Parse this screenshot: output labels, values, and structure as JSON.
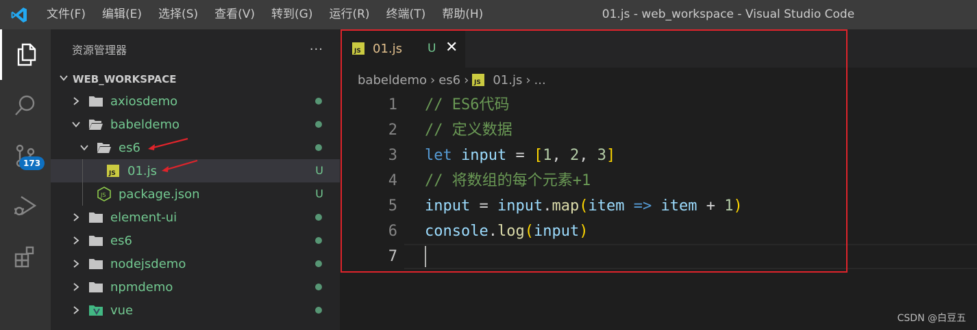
{
  "titlebar": {
    "menu": [
      "文件(F)",
      "编辑(E)",
      "选择(S)",
      "查看(V)",
      "转到(G)",
      "运行(R)",
      "终端(T)",
      "帮助(H)"
    ],
    "window_title": "01.js - web_workspace - Visual Studio Code"
  },
  "activity": {
    "scm_badge": "173",
    "icons": [
      "explorer-icon",
      "search-icon",
      "source-control-icon",
      "run-debug-icon",
      "extensions-icon"
    ]
  },
  "explorer": {
    "title": "资源管理器",
    "more": "···",
    "workspace": "WEB_WORKSPACE",
    "rows": [
      {
        "label": "axiosdemo",
        "type": "folder",
        "expanded": false,
        "status": ""
      },
      {
        "label": "babeldemo",
        "type": "folder",
        "expanded": true,
        "status": ""
      },
      {
        "label": "es6",
        "type": "folder",
        "expanded": true,
        "status": ""
      },
      {
        "label": "01.js",
        "type": "js",
        "status": "U"
      },
      {
        "label": "package.json",
        "type": "json",
        "status": "U"
      },
      {
        "label": "element-ui",
        "type": "folder",
        "expanded": false,
        "status": ""
      },
      {
        "label": "es6",
        "type": "folder",
        "expanded": false,
        "status": ""
      },
      {
        "label": "nodejsdemo",
        "type": "folder",
        "expanded": false,
        "status": ""
      },
      {
        "label": "npmdemo",
        "type": "folder",
        "expanded": false,
        "status": ""
      },
      {
        "label": "vue",
        "type": "vue-folder",
        "expanded": false,
        "status": ""
      }
    ]
  },
  "editor": {
    "tab": {
      "icon": "JS",
      "label": "01.js",
      "status": "U"
    },
    "breadcrumb": [
      "babeldemo",
      "es6",
      "01.js",
      "..."
    ],
    "lines": [
      {
        "no": "1",
        "text": "// ES6代码"
      },
      {
        "no": "2",
        "text": "// 定义数据"
      },
      {
        "no": "3",
        "text": "let input = [1, 2, 3]"
      },
      {
        "no": "4",
        "text": "// 将数组的每个元素+1"
      },
      {
        "no": "5",
        "text": "input = input.map(item => item + 1)"
      },
      {
        "no": "6",
        "text": "console.log(input)"
      },
      {
        "no": "7",
        "text": ""
      }
    ]
  },
  "colors": {
    "accent_red": "#e0242b",
    "git_untracked": "#73c991",
    "badge_blue": "#0e70c0"
  },
  "watermark": "CSDN @白豆五"
}
